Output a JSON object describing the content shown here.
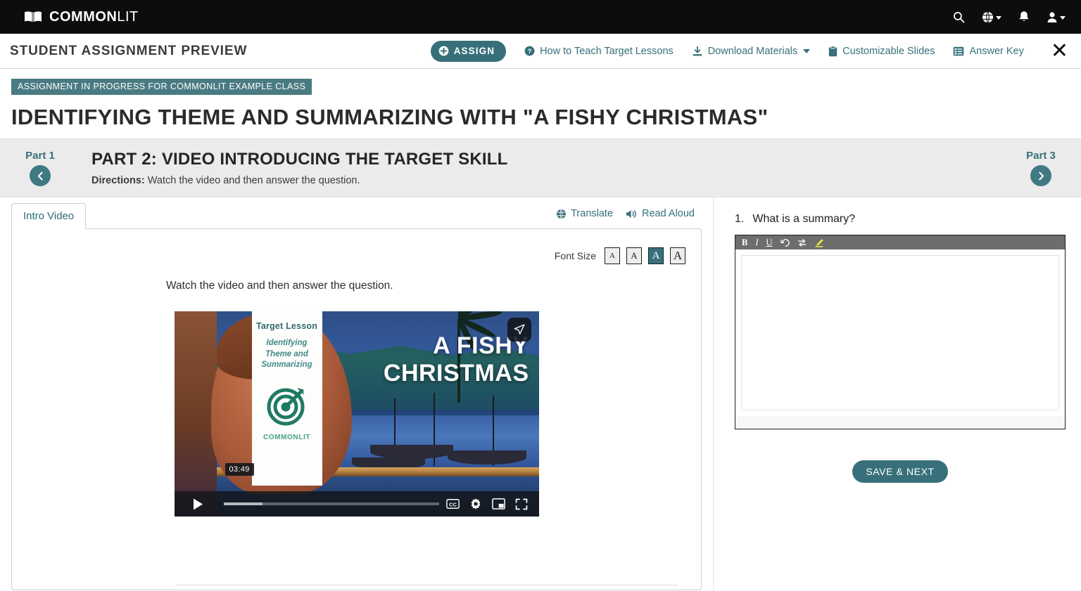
{
  "topnav": {
    "brand_bold": "COMMON",
    "brand_light": "LIT",
    "icons": [
      {
        "name": "search-icon",
        "label": "Search"
      },
      {
        "name": "globe-icon",
        "label": "Language"
      },
      {
        "name": "bell-icon",
        "label": "Notifications"
      },
      {
        "name": "user-icon",
        "label": "Account"
      }
    ]
  },
  "toolbar": {
    "preview_title": "STUDENT ASSIGNMENT PREVIEW",
    "assign_label": "ASSIGN",
    "how_to_teach_label": "How to Teach Target Lessons",
    "download_materials_label": "Download Materials",
    "customizable_slides_label": "Customizable Slides",
    "answer_key_label": "Answer Key",
    "close_label": "✕"
  },
  "header": {
    "status_badge": "ASSIGNMENT IN PROGRESS FOR COMMONLIT EXAMPLE CLASS",
    "lesson_title": "IDENTIFYING THEME AND SUMMARIZING WITH \"A FISHY CHRISTMAS\""
  },
  "partbar": {
    "prev_label": "Part 1",
    "next_label": "Part 3",
    "heading": "PART 2: VIDEO INTRODUCING THE TARGET SKILL",
    "directions_label": "Directions:",
    "directions_text": "Watch the video and then answer the question."
  },
  "reading": {
    "tab_label": "Intro Video",
    "translate_label": "Translate",
    "read_aloud_label": "Read Aloud",
    "font_size_label": "Font Size",
    "font_size_options": [
      "A",
      "A",
      "A",
      "A"
    ],
    "font_size_selected_index": 2,
    "body_text": "Watch the video and then answer the question."
  },
  "video": {
    "card_title": "Target Lesson",
    "card_subtitle": "Identifying\nTheme and\nSummarizing",
    "brand_bold": "COMMON",
    "brand_light": "LIT",
    "title_line1": "A FISHY",
    "title_line2": "CHRISTMAS",
    "time_label": "03:49",
    "share_icon": "share-icon",
    "controls": [
      "play-icon",
      "cc-icon",
      "settings-gear-icon",
      "picture-in-picture-icon",
      "fullscreen-icon"
    ]
  },
  "question": {
    "number": "1.",
    "text": "What is a summary?",
    "editor_tools": [
      {
        "name": "bold-icon",
        "label": "B"
      },
      {
        "name": "italic-icon",
        "label": "I"
      },
      {
        "name": "underline-icon",
        "label": "U"
      },
      {
        "name": "undo-icon",
        "label": "↺"
      },
      {
        "name": "redo-icon",
        "label": "⇄"
      },
      {
        "name": "highlighter-icon",
        "label": "✎"
      }
    ],
    "answer_value": "",
    "answer_placeholder": "",
    "save_label": "SAVE & NEXT"
  },
  "colors": {
    "teal": "#37707a",
    "teal_dark": "#3f7982",
    "badge_teal": "#4a7b82",
    "nav_black": "#0d0d0d",
    "partbar_gray": "#ebebeb",
    "editor_toolbar_gray": "#6d6d6d",
    "highlighter_yellow": "#eded3a"
  }
}
